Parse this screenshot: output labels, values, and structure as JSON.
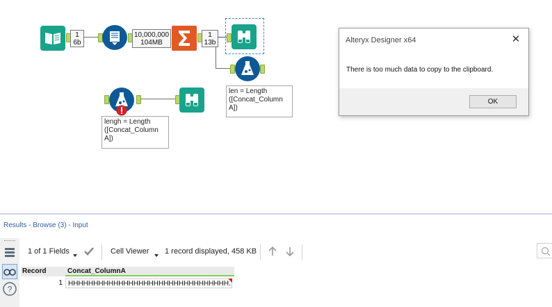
{
  "canvas": {
    "count_box_1": {
      "line1": "1",
      "line2": "6b"
    },
    "count_box_2": {
      "line1": "10,000,000",
      "line2": "104MB"
    },
    "count_box_3": {
      "line1": "1",
      "line2": "13b"
    },
    "annotation_formula_top": "len = Length\n([Concat_Column\nA])",
    "annotation_formula_bottom": "lengh = Length\n([Concat_Column\nA])"
  },
  "dialog": {
    "title": "Alteryx Designer x64",
    "message": "There is too much data to copy to the clipboard.",
    "ok_label": "OK",
    "close_glyph": "✕"
  },
  "results": {
    "title": "Results - Browse (3) - Input",
    "fields_label": "1 of 1 Fields",
    "cell_viewer_label": "Cell Viewer",
    "records_label": "1 record displayed, 458 KB",
    "columns": [
      "Record",
      "Concat_ColumnA"
    ],
    "rows": [
      {
        "record": "1",
        "value": "HHHHHHHHHHHHHHHHHHHHHHHHHHHHHHHH..."
      }
    ]
  },
  "colors": {
    "tool_green": "#1aa38b",
    "tool_blue": "#0f5a96",
    "tool_orange": "#e05a23",
    "error_red": "#d91f26",
    "link_blue": "#2a5f9c"
  },
  "icons": [
    "input-data-icon",
    "select-icon",
    "summarize-icon",
    "browse-icon",
    "formula-icon",
    "error-icon",
    "record-list-icon",
    "binoculars-icon",
    "help-icon",
    "caret-down-icon",
    "check-icon",
    "arrow-up-icon",
    "arrow-down-icon",
    "search-icon",
    "close-icon"
  ]
}
